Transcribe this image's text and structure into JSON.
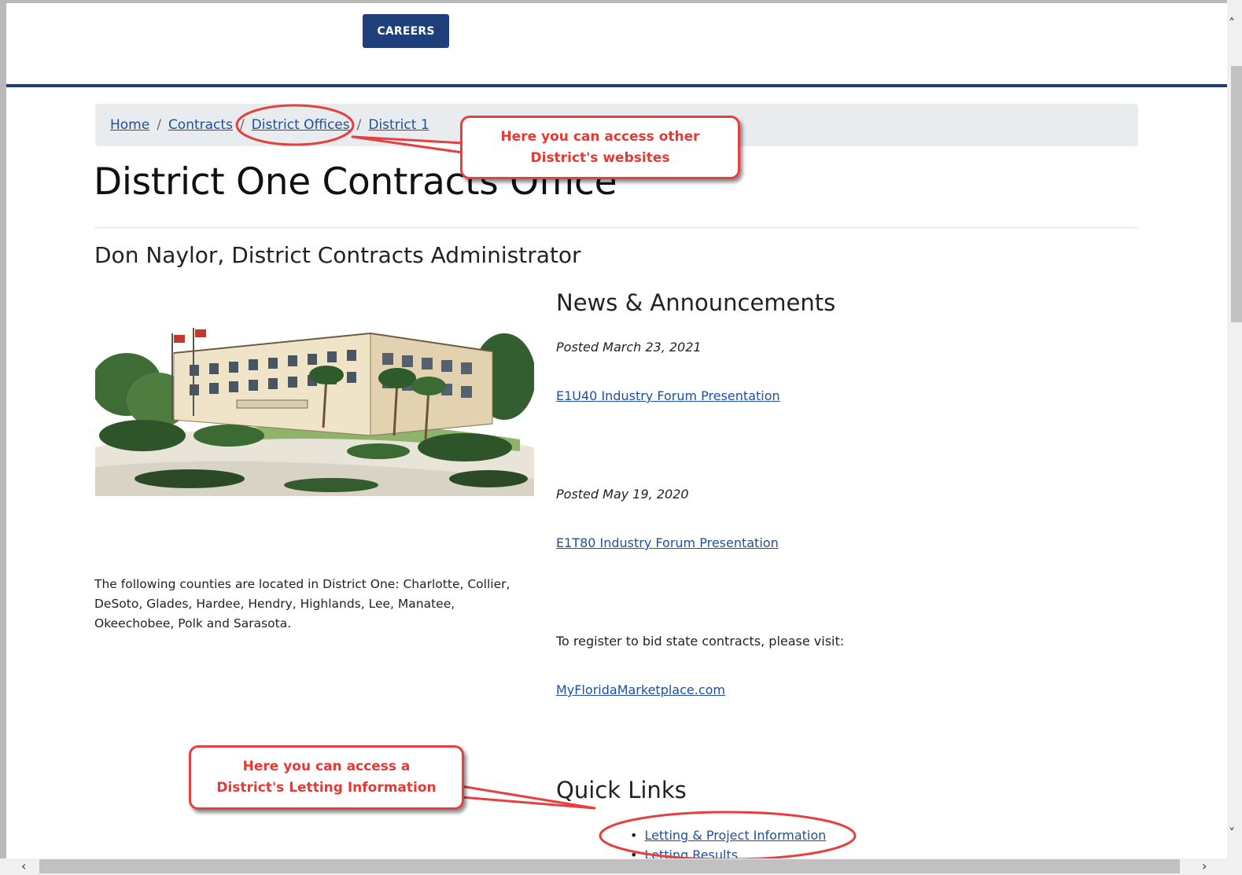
{
  "header": {
    "careers_label": "CAREERS"
  },
  "breadcrumb": {
    "home": "Home",
    "contracts": "Contracts",
    "district_offices": "District Offices",
    "district": "District 1",
    "separator": "/"
  },
  "page": {
    "title": "District One Contracts Office",
    "subtitle": "Don Naylor, District Contracts Administrator",
    "counties_text": "The following counties are located in District One: Charlotte, Collier, DeSoto, Glades, Hardee, Hendry, Highlands, Lee, Manatee, Okeechobee, Polk and Sarasota."
  },
  "news": {
    "heading": "News & Announcements",
    "items": [
      {
        "posted": "Posted March 23, 2021",
        "link": "E1U40 Industry Forum Presentation"
      },
      {
        "posted": "Posted May 19, 2020",
        "link": "E1T80 Industry Forum Presentation"
      }
    ],
    "register_text": "To register to bid state contracts, please visit:",
    "register_link": "MyFloridaMarketplace.com"
  },
  "quick_links": {
    "heading": "Quick Links",
    "items": [
      "Letting & Project Information",
      "Letting Results"
    ]
  },
  "annotations": {
    "callout_1": [
      "Here you can access other",
      "District's websites"
    ],
    "callout_2": [
      "Here you can access a",
      "District's Letting Information"
    ],
    "color": "#e53935"
  },
  "colors": {
    "brand_navy": "#1f3f7a",
    "link": "#1e50a2",
    "breadcrumb_bg": "#e9ecef"
  },
  "icons": {
    "scroll_left": "chevron-left-icon",
    "scroll_right": "chevron-right-icon",
    "scroll_up": "chevron-up-icon",
    "scroll_down": "chevron-down-icon"
  }
}
